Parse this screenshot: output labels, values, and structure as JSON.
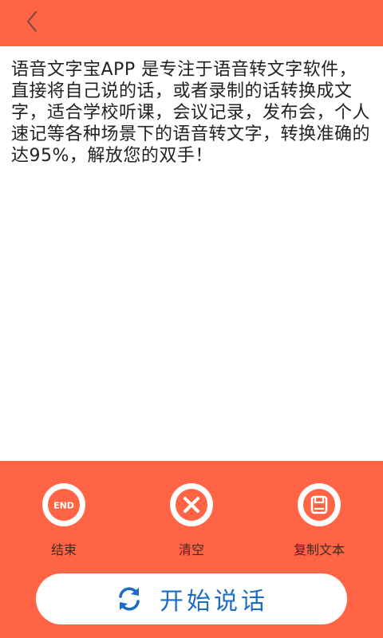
{
  "header": {
    "back_icon": "chevron-left-icon",
    "background_color": "#FF6545"
  },
  "content": {
    "text": "语音文字宝APP 是专注于语音转文字软件，直接将自己说的话，或者录制的话转换成文字，适合学校听课，会议记录，发布会，个人速记等各种场景下的语音转文字，转换准确的达95%，解放您的双手！"
  },
  "actions": [
    {
      "icon": "end-icon",
      "icon_text": "END",
      "label": "结束"
    },
    {
      "icon": "clear-x-icon",
      "label": "清空"
    },
    {
      "icon": "save-disk-icon",
      "label": "复制文本"
    }
  ],
  "start": {
    "icon": "refresh-icon",
    "label": "开始说话",
    "text_color": "#1E6DC2"
  }
}
